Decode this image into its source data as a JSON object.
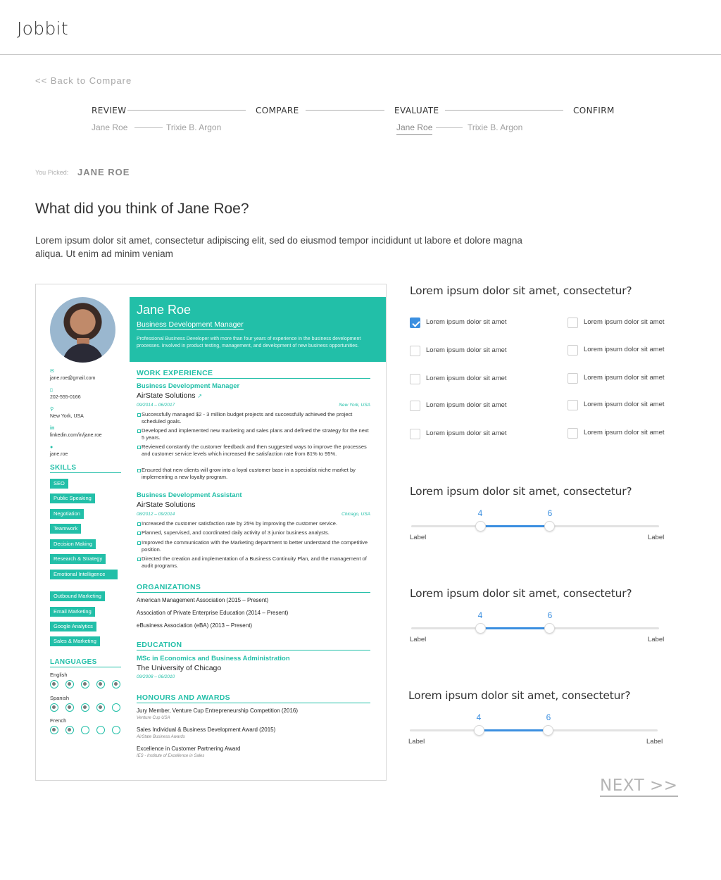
{
  "app": {
    "title": "Jobbit"
  },
  "nav": {
    "back_label": "<< Back to Compare"
  },
  "steps": {
    "review": "REVIEW",
    "compare": "COMPARE",
    "evaluate": "EVALUATE",
    "confirm": "CONFIRM",
    "review_a": "Jane Roe",
    "review_b": "Trixie B. Argon",
    "evaluate_a": "Jane Roe",
    "evaluate_b": "Trixie B. Argon"
  },
  "picked": {
    "label": "You Picked:",
    "name": "JANE ROE"
  },
  "page": {
    "title": "What did you think of Jane Roe?",
    "intro": "Lorem ipsum dolor sit amet, consectetur adipiscing elit, sed do eiusmod tempor incididunt ut labore et dolore magna aliqua. Ut enim ad minim veniam"
  },
  "resume": {
    "name": "Jane Roe",
    "role": "Business Development Manager",
    "summary": "Professional Business Developer with more than four years of experience in the business development processes. Involved in product testing, management, and development of new business opportunities.",
    "contact": {
      "email": "jane.roe@gmail.com",
      "phone": "202-555-0166",
      "location": "New York, USA",
      "linkedin": "linkedin.com/in/jane.roe",
      "skype": "jane.roe"
    },
    "skills_heading": "SKILLS",
    "skills": [
      "SEO",
      "Public Speaking",
      "Negotiation",
      "Teamwork",
      "Decision Making",
      "Research & Strategy",
      "Emotional Intelligence",
      "Outbound Marketing",
      "Email Marketing",
      "Google Analytics",
      "Sales & Marketing"
    ],
    "languages_heading": "LANGUAGES",
    "languages": [
      {
        "name": "English",
        "level": 5
      },
      {
        "name": "Spanish",
        "level": 4
      },
      {
        "name": "French",
        "level": 2
      }
    ],
    "work_heading": "WORK EXPERIENCE",
    "jobs": [
      {
        "title": "Business Development Manager",
        "company": "AirState Solutions",
        "dates": "09/2014 – 06/2017",
        "location": "New York, USA",
        "bullets": [
          "Successfully managed $2 - 3 million budget projects and successfully achieved the project scheduled goals.",
          "Developed and implemented new marketing and sales plans and defined the strategy for the next 5 years.",
          "Reviewed constantly the customer feedback and then suggested ways to improve the processes and customer service levels which increased the satisfaction rate from 81% to 95%.",
          "Ensured that new clients will grow into a loyal customer base in a specialist niche market by implementing a new loyalty program."
        ]
      },
      {
        "title": "Business Development Assistant",
        "company": "AirState Solutions",
        "dates": "08/2012 – 09/2014",
        "location": "Chicago, USA",
        "bullets": [
          "Increased the customer satisfaction rate by 25% by improving the customer service.",
          "Planned, supervised, and coordinated daily activity of 3 junior business analysts.",
          "Improved the communication with the Marketing department to better understand the competitive position.",
          "Directed the creation and implementation of a Business Continuity Plan, and the management of audit programs."
        ]
      }
    ],
    "org_heading": "ORGANIZATIONS",
    "orgs": [
      "American Management Association (2015 – Present)",
      "Association of Private Enterprise Education (2014 – Present)",
      "eBusiness Association (eBA) (2013 – Present)"
    ],
    "edu_heading": "EDUCATION",
    "edu": {
      "degree": "MSc in Economics and Business Administration",
      "school": "The University of Chicago",
      "dates": "09/2008 – 06/2010"
    },
    "awards_heading": "HONOURS AND AWARDS",
    "awards": [
      {
        "title": "Jury Member, Venture Cup Entrepreneurship Competition (2016)",
        "org": "Venture Cup USA"
      },
      {
        "title": "Sales Individual & Business Development Award (2015)",
        "org": "AirState Business Awards"
      },
      {
        "title": "Excellence in Customer Partnering Award",
        "org": "IES - Institute of Excellence in Sales"
      }
    ]
  },
  "survey": {
    "q1": "Lorem ipsum dolor sit amet, consectetur?",
    "checkboxes": [
      {
        "label": "Lorem ipsum dolor sit amet",
        "checked": true
      },
      {
        "label": "Lorem ipsum dolor sit amet",
        "checked": false
      },
      {
        "label": "Lorem ipsum dolor sit amet",
        "checked": false
      },
      {
        "label": "Lorem ipsum dolor sit amet",
        "checked": false
      },
      {
        "label": "Lorem ipsum dolor sit amet",
        "checked": false
      },
      {
        "label": "Lorem ipsum dolor sit amet",
        "checked": false
      },
      {
        "label": "Lorem ipsum dolor sit amet",
        "checked": false
      },
      {
        "label": "Lorem ipsum dolor sit amet",
        "checked": false
      },
      {
        "label": "Lorem ipsum dolor sit amet",
        "checked": false
      },
      {
        "label": "Lorem ipsum dolor sit amet",
        "checked": false
      }
    ],
    "sliders": [
      {
        "question": "Lorem ipsum dolor sit amet, consectetur?",
        "low": "4",
        "high": "6",
        "min_label": "Label",
        "max_label": "Label"
      },
      {
        "question": "Lorem ipsum dolor sit amet, consectetur?",
        "low": "4",
        "high": "6",
        "min_label": "Label",
        "max_label": "Label"
      },
      {
        "question": "Lorem ipsum dolor sit amet, consectetur?",
        "low": "4",
        "high": "6",
        "min_label": "Label",
        "max_label": "Label"
      }
    ],
    "next_label": "NEXT >>"
  },
  "colors": {
    "teal": "#22bfa8",
    "blue": "#3b8fe0"
  }
}
